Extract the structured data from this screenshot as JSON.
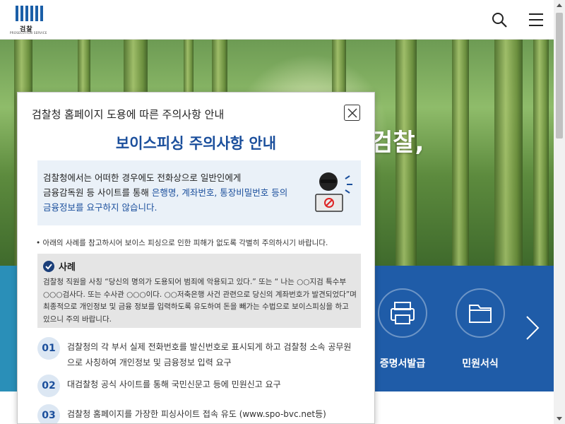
{
  "header": {
    "logo_text": "검찰",
    "logo_sub": "PROSECUTION SERVICE",
    "search_label": "search",
    "menu_label": "menu"
  },
  "hero": {
    "text": "검찰,"
  },
  "quick_menu": {
    "items": [
      {
        "label": "증명서발급",
        "icon": "printer-icon"
      },
      {
        "label": "민원서식",
        "icon": "folder-icon"
      }
    ]
  },
  "popup": {
    "title": "검찰청 홈페이지 도용에 따른 주의사항 안내",
    "heading": "보이스피싱 주의사항 안내",
    "notice": {
      "line1": "검찰청에서는 어떠한 경우에도 전화상으로 일반인에게",
      "line2_plain": "금융감독원 등 사이트를 통해 ",
      "line2_hl": "은행명, 계좌번호, 통장비밀번호 등의",
      "line3_hl": "금융정보를 요구하지 않습니다."
    },
    "tip": "아래의 사례를 참고하시어 보이스 피싱으로 인한 피해가 없도록 각별히 주의하시기 바랍니다.",
    "case_title": "사례",
    "case_body": "검찰청 직원을 사칭 “당신의 명의가 도용되어 범죄에 악용되고 있다.” 또는 “ 나는 ○○지검 특수부 ○○○검사다. 또는 수사관 ○○○이다. ○○저축은행 사건 관련으로 당신의 계좌번호가 발견되었다”며 최종적으로 개인정보 및 금융 정보를 입력하도록 유도하여 돈을 빼가는 수법으로 보이스피싱을 하고 있으니 주의 바랍니다.",
    "steps": [
      {
        "num": "01",
        "text": "검찰청의 각 부서 실제 전화번호를 발신번호로 표시되게 하고 검찰청 소속 공무원으로 사칭하여 개인정보 및 금융정보 입력 요구"
      },
      {
        "num": "02",
        "text": "대검찰청 공식 사이트를 통해 국민신문고 등에 민원신고 요구"
      },
      {
        "num": "03",
        "text": "검찰청 홈페이지를 가장한 피싱사이트 접속 유도 (www.spo-bvc.net등)"
      }
    ]
  },
  "colors": {
    "brand_blue": "#1b4f9c",
    "quick_band": "#1f5ca8",
    "notice_bg": "#eaf1f8",
    "case_bg": "#e5e5e5"
  }
}
